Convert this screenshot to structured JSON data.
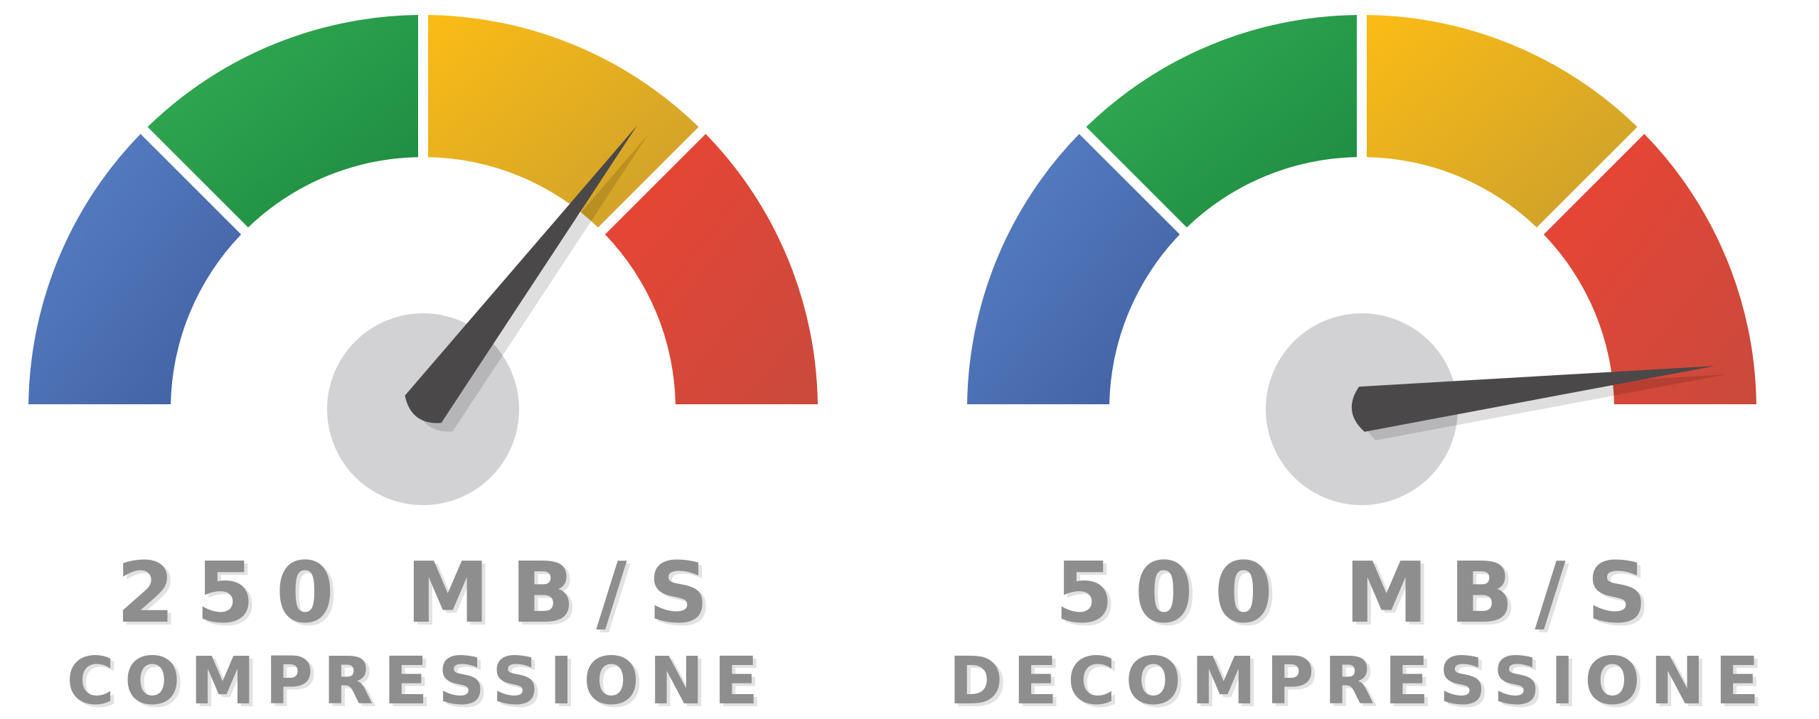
{
  "gauges": [
    {
      "id": "compression",
      "speed_text": "250 MB/S",
      "mode_text": "COMPRESSIONE",
      "needle_angle_deg": 53
    },
    {
      "id": "decompression",
      "speed_text": "500 MB/S",
      "mode_text": "DECOMPRESSIONE",
      "needle_angle_deg": 7
    }
  ],
  "segment_colors": {
    "blue": [
      "#5a82c8",
      "#3f5fa0"
    ],
    "green": [
      "#35ae54",
      "#1b8840"
    ],
    "yellow": [
      "#fbbc15",
      "#c99e2e"
    ],
    "red": [
      "#ec4433",
      "#c94a3c"
    ]
  },
  "needle_color": "#4a4848",
  "hub_color": "#d2d2d4",
  "label_color": "#8e8e8e"
}
